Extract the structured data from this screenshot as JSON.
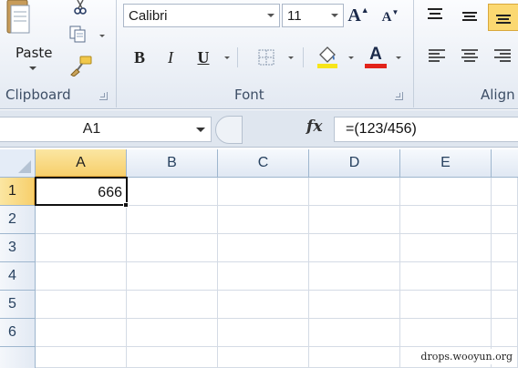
{
  "ribbon": {
    "clipboard": {
      "paste_label": "Paste",
      "group_label": "Clipboard"
    },
    "font": {
      "font_name": "Calibri",
      "font_size": "11",
      "bold": "B",
      "italic": "I",
      "underline": "U",
      "grow_font": "A",
      "shrink_font": "A",
      "font_color_glyph": "A",
      "group_label": "Font"
    },
    "alignment": {
      "group_label": "Align"
    },
    "colors": {
      "highlight": "#f7e51a",
      "font_color": "#e2231a",
      "active_button": "#fbd871"
    }
  },
  "formula_bar": {
    "name_box": "A1",
    "fx_label": "fx",
    "formula": "=(123/456)"
  },
  "grid": {
    "columns": [
      "A",
      "B",
      "C",
      "D",
      "E"
    ],
    "rows": [
      "1",
      "2",
      "3",
      "4",
      "5",
      "6"
    ],
    "cells": {
      "A1": "666"
    },
    "selected_cell": "A1"
  },
  "watermark": "drops.wooyun.org"
}
